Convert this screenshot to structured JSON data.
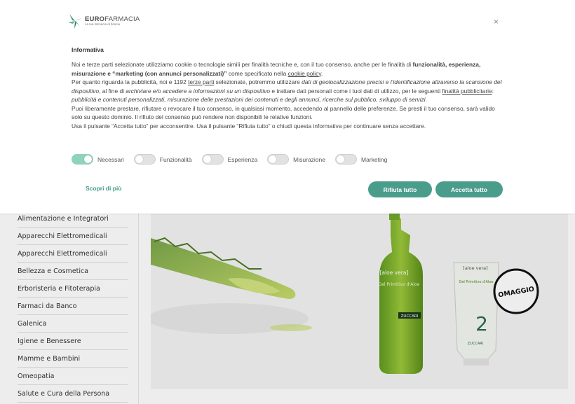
{
  "banner": {
    "brand_bold": "EURO",
    "brand_rest": "FARMACIA",
    "tagline": "La tua farmacia di fiducia",
    "close": "×",
    "title": "Informativa",
    "p1_a": "Noi e terze parti selezionate utilizziamo cookie o tecnologie simili per finalità tecniche e, con il tuo consenso, anche per le finalità di ",
    "p1_b": "funzionalità, esperienza, misurazione e “marketing (con annunci personalizzati)”",
    "p1_c": " come specificato nella ",
    "p1_link": "cookie policy",
    "p1_d": ".",
    "p2_a": "Per quanto riguarda la pubblicità, noi e 1192 ",
    "p2_link1": "terze parti",
    "p2_b": " selezionate, potremmo utilizzare ",
    "p2_i1": "dati di geolocalizzazione precisi e l’identificazione attraverso la scansione del dispositivo",
    "p2_c": ", al fine di ",
    "p2_i2": "archiviare e/o accedere a informazioni su un dispositivo",
    "p2_d": " e trattare dati personali come i tuoi dati di utilizzo, per le seguenti ",
    "p2_link2": "finalità pubblicitarie",
    "p2_e": ": ",
    "p2_i3": "pubblicità e contenuti personalizzati, misurazione delle prestazioni dei contenuti e degli annunci, ricerche sul pubblico, sviluppo di servizi",
    "p2_f": ".",
    "p3": "Puoi liberamente prestare, rifiutare o revocare il tuo consenso, in qualsiasi momento, accedendo al pannello delle preferenze. Se presti il tuo consenso, sarà valido solo su questo dominio. Il rifiuto del consenso può rendere non disponibili le relative funzioni.",
    "p4": "Usa il pulsante “Accetta tutto” per acconsentire. Usa il pulsante “Rifiuta tutto” o chiudi questa informativa per continuare senza accettare.",
    "toggles": [
      {
        "label": "Necessari",
        "on": true
      },
      {
        "label": "Funzionalità",
        "on": false
      },
      {
        "label": "Esperienza",
        "on": false
      },
      {
        "label": "Misurazione",
        "on": false
      },
      {
        "label": "Marketing",
        "on": false
      }
    ],
    "learn_more": "Scopri di più",
    "reject": "Rifiuta tutto",
    "accept": "Accetta tutto"
  },
  "sidebar": {
    "items": [
      "Alimentazione e Integratori",
      "Apparecchi Elettromedicali",
      "Apparecchi Elettromedicali",
      "Bellezza e Cosmetica",
      "Erboristeria e Fitoterapia",
      "Farmaci da Banco",
      "Galenica",
      "Igiene e Benessere",
      "Mamme e Bambini",
      "Omeopatia",
      "Salute e Cura della Persona"
    ]
  },
  "hero": {
    "bottle_brand": "[aloe vera]",
    "bottle_name": "Gel Primitivo d'Aloe",
    "bottle_maker": "ZUCCARI",
    "tube_brand": "[aloe vera]",
    "tube_name": "Gel Primitivo d'Aloe",
    "tube_number": "2",
    "tube_maker": "ZUCCARI",
    "badge": "OMAGGIO"
  },
  "colors": {
    "accent": "#4a9d8b",
    "toggle_on": "#8fd3bd",
    "link_green": "#3f9a86"
  }
}
